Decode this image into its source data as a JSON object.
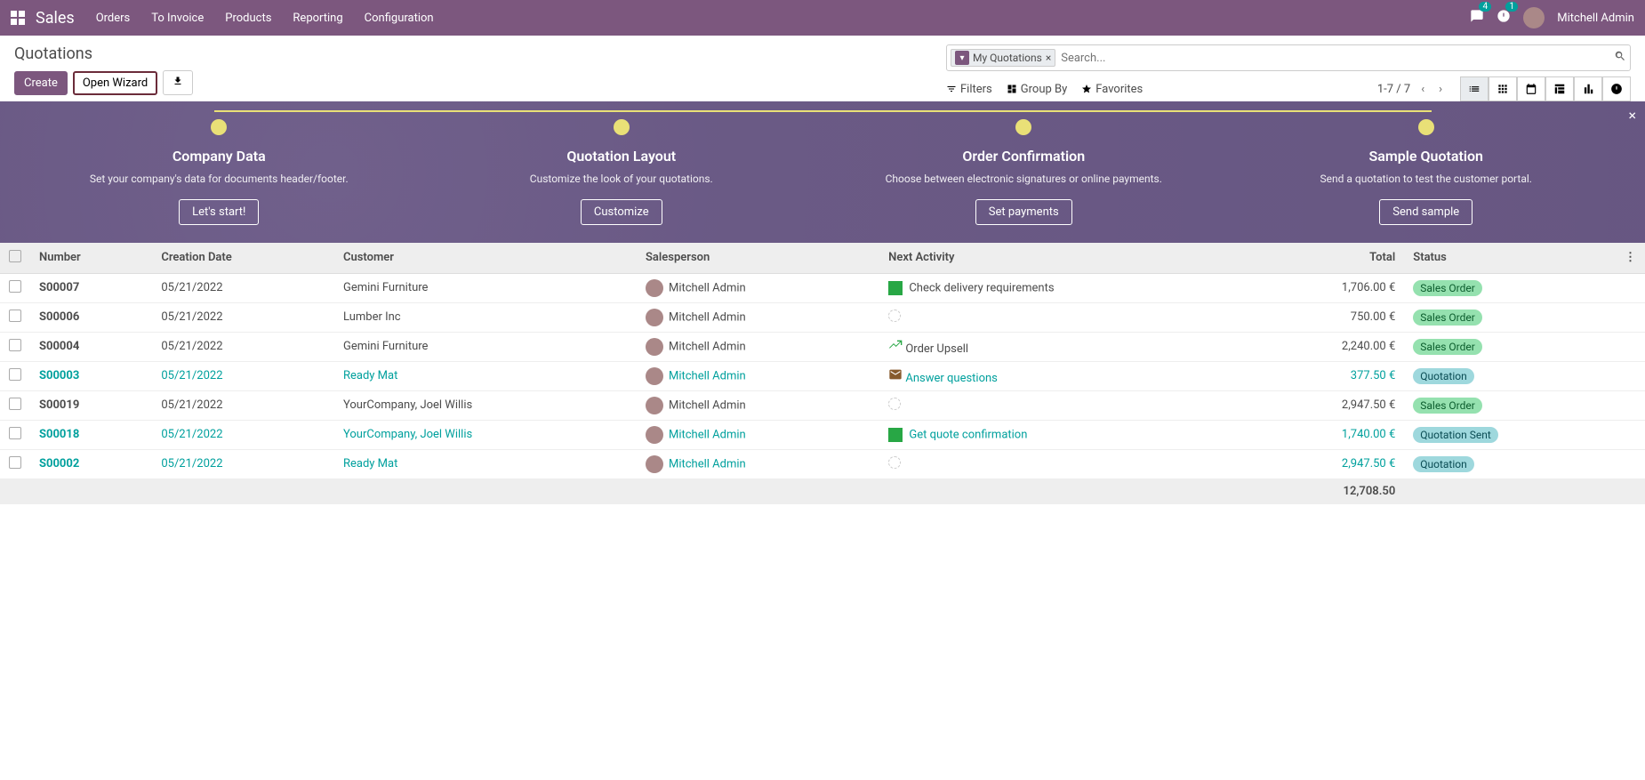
{
  "nav": {
    "app": "Sales",
    "items": [
      "Orders",
      "To Invoice",
      "Products",
      "Reporting",
      "Configuration"
    ],
    "msg_badge": "4",
    "activity_badge": "1",
    "user": "Mitchell Admin"
  },
  "header": {
    "breadcrumb": "Quotations",
    "create": "Create",
    "wizard": "Open Wizard",
    "filter_tag": "My Quotations",
    "search_placeholder": "Search...",
    "filters": "Filters",
    "groupby": "Group By",
    "favorites": "Favorites",
    "pager": "1-7 / 7"
  },
  "onboard": {
    "steps": [
      {
        "title": "Company Data",
        "desc": "Set your company's data for documents header/footer.",
        "btn": "Let's start!"
      },
      {
        "title": "Quotation Layout",
        "desc": "Customize the look of your quotations.",
        "btn": "Customize"
      },
      {
        "title": "Order Confirmation",
        "desc": "Choose between electronic signatures or online payments.",
        "btn": "Set payments"
      },
      {
        "title": "Sample Quotation",
        "desc": "Send a quotation to test the customer portal.",
        "btn": "Send sample"
      }
    ]
  },
  "table": {
    "cols": {
      "number": "Number",
      "date": "Creation Date",
      "customer": "Customer",
      "sales": "Salesperson",
      "activity": "Next Activity",
      "total": "Total",
      "status": "Status"
    },
    "rows": [
      {
        "num": "S00007",
        "date": "05/21/2022",
        "cust": "Gemini Furniture",
        "sp": "Mitchell Admin",
        "act": "Check delivery requirements",
        "act_type": "task",
        "total": "1,706.00 €",
        "status": "Sales Order",
        "pill": "green",
        "link": false
      },
      {
        "num": "S00006",
        "date": "05/21/2022",
        "cust": "Lumber Inc",
        "sp": "Mitchell Admin",
        "act": "",
        "act_type": "none",
        "total": "750.00 €",
        "status": "Sales Order",
        "pill": "green",
        "link": false
      },
      {
        "num": "S00004",
        "date": "05/21/2022",
        "cust": "Gemini Furniture",
        "sp": "Mitchell Admin",
        "act": "Order Upsell",
        "act_type": "upsell",
        "total": "2,240.00 €",
        "status": "Sales Order",
        "pill": "green",
        "link": false
      },
      {
        "num": "S00003",
        "date": "05/21/2022",
        "cust": "Ready Mat",
        "sp": "Mitchell Admin",
        "act": "Answer questions",
        "act_type": "mail",
        "total": "377.50 €",
        "status": "Quotation",
        "pill": "teal",
        "link": true
      },
      {
        "num": "S00019",
        "date": "05/21/2022",
        "cust": "YourCompany, Joel Willis",
        "sp": "Mitchell Admin",
        "act": "",
        "act_type": "none",
        "total": "2,947.50 €",
        "status": "Sales Order",
        "pill": "green",
        "link": false
      },
      {
        "num": "S00018",
        "date": "05/21/2022",
        "cust": "YourCompany, Joel Willis",
        "sp": "Mitchell Admin",
        "act": "Get quote confirmation",
        "act_type": "task",
        "total": "1,740.00 €",
        "status": "Quotation Sent",
        "pill": "teal",
        "link": true
      },
      {
        "num": "S00002",
        "date": "05/21/2022",
        "cust": "Ready Mat",
        "sp": "Mitchell Admin",
        "act": "",
        "act_type": "none",
        "total": "2,947.50 €",
        "status": "Quotation",
        "pill": "teal",
        "link": true
      }
    ],
    "footer_total": "12,708.50"
  }
}
